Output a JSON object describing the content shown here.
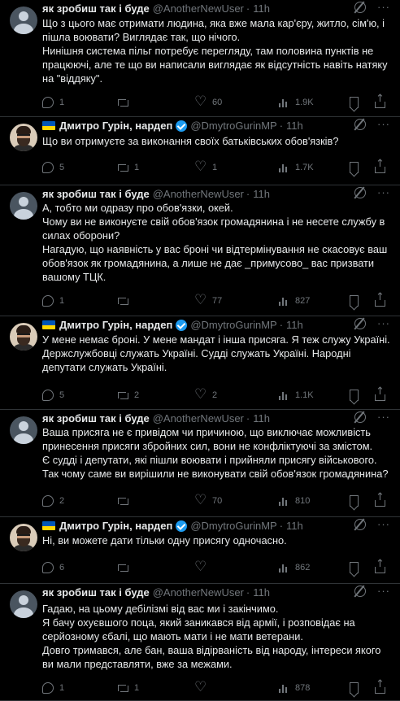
{
  "tweets": [
    {
      "name": "як зробиш так і буде",
      "handle": "@AnotherNewUser",
      "time": "11h",
      "avatar": "anon",
      "flag": false,
      "verified": false,
      "lines": [
        "Що з цього має отримати людина, яка вже мала кар'єру, житло, сім'ю, і пішла воювати? Виглядає так, що нічого.",
        "Нинішня система пільг потребує перегляду, там половина пунктів не працюючі, але те що ви написали виглядає як відсутність навіть натяку на \"віддяку\"."
      ],
      "replies": "1",
      "retweets": "",
      "likes": "60",
      "views": "1.9K"
    },
    {
      "name": "Дмитро Гурін, нардеп",
      "handle": "@DmytroGurinMP",
      "time": "11h",
      "avatar": "man",
      "flag": true,
      "verified": true,
      "lines": [
        "Що ви отримуєте за виконання своїх батьківських обов'язків?"
      ],
      "replies": "5",
      "retweets": "1",
      "likes": "1",
      "views": "1.7K"
    },
    {
      "name": "як зробиш так і буде",
      "handle": "@AnotherNewUser",
      "time": "11h",
      "avatar": "anon",
      "flag": false,
      "verified": false,
      "lines": [
        "А, тобто ми одразу про обов'язки, окей.",
        "Чому ви не виконуєте свій обов'язок громадянина і не несете службу в силах оборони?",
        "Нагадую, що наявність у вас броні чи відтермінування не скасовує ваш обов'язок як громадянина, а лише не дає _примусово_ вас призвати вашому ТЦК."
      ],
      "replies": "1",
      "retweets": "",
      "likes": "77",
      "views": "827"
    },
    {
      "name": "Дмитро Гурін, нардеп",
      "handle": "@DmytroGurinMP",
      "time": "11h",
      "avatar": "man",
      "flag": true,
      "verified": true,
      "lines": [
        "У мене немає броні. У мене мандат і інша присяга. Я теж служу Україні. Держслужбовці служать Україні. Судді служать Україні. Народні депутати служать Україні."
      ],
      "replies": "5",
      "retweets": "2",
      "likes": "2",
      "views": "1.1K"
    },
    {
      "name": "як зробиш так і буде",
      "handle": "@AnotherNewUser",
      "time": "11h",
      "avatar": "anon",
      "flag": false,
      "verified": false,
      "lines": [
        "Ваша присяга не є привідом чи причиною, що виключає можливість принесення присяги збройних сил, вони не конфліктуючі за змістом.",
        "Є судді і депутати, які пішли воювати і прийняли присягу військового.",
        "Так чому саме ви вирішили не виконувати свій обов'язок громадянина?"
      ],
      "replies": "2",
      "retweets": "",
      "likes": "70",
      "views": "810"
    },
    {
      "name": "Дмитро Гурін, нардеп",
      "handle": "@DmytroGurinMP",
      "time": "11h",
      "avatar": "man",
      "flag": true,
      "verified": true,
      "lines": [
        "Ні, ви можете дати тільки одну присягу одночасно."
      ],
      "replies": "6",
      "retweets": "",
      "likes": "",
      "views": "862"
    },
    {
      "name": "як зробиш так і буде",
      "handle": "@AnotherNewUser",
      "time": "11h",
      "avatar": "anon",
      "flag": false,
      "verified": false,
      "lines": [
        "Гадаю, на цьому дебілізмі від вас ми і закінчимо.",
        "Я бачу охуєвшого поца, який заникався від армії, і розповідає на серйозному єбалі, що мають мати і не мати ветерани.",
        "Довго тримався, але бан, ваша відірваність від народу, інтереси якого ви мали представляти, вже за межами."
      ],
      "replies": "1",
      "retweets": "1",
      "likes": "",
      "views": "878"
    }
  ]
}
